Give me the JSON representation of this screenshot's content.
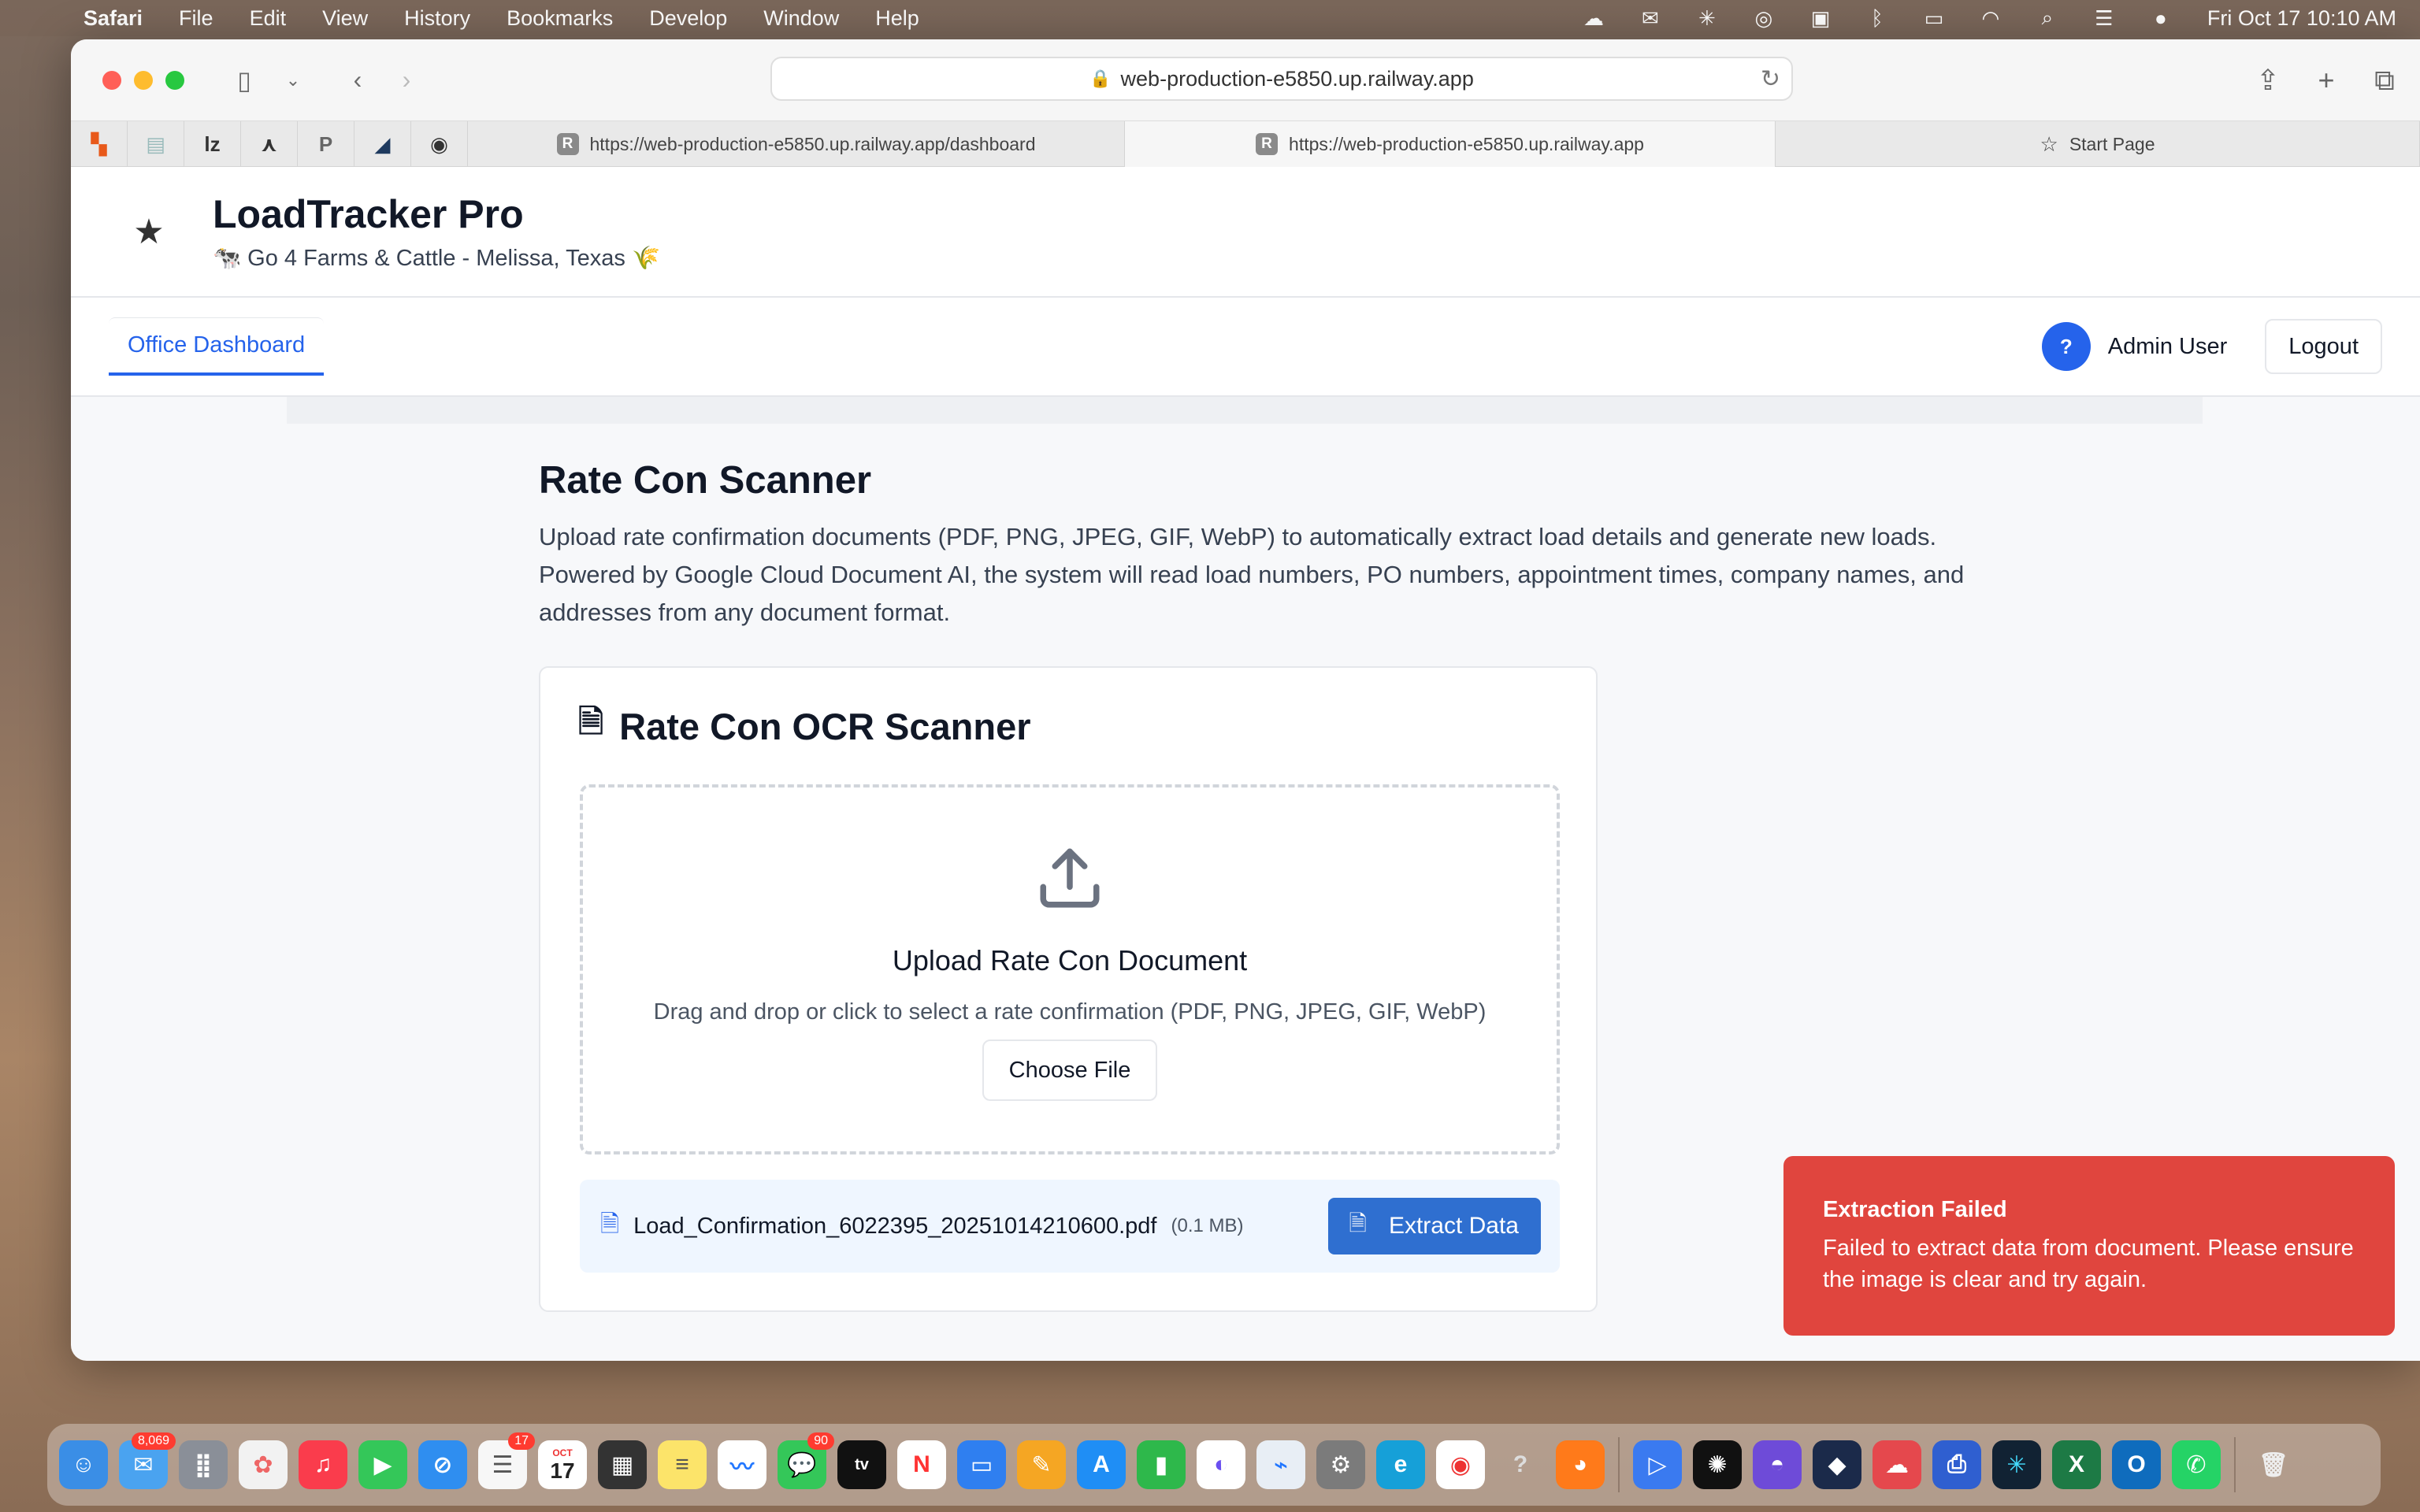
{
  "menubar": {
    "app_name": "Safari",
    "items": [
      "File",
      "Edit",
      "View",
      "History",
      "Bookmarks",
      "Develop",
      "Window",
      "Help"
    ],
    "clock": "Fri Oct 17  10:10 AM",
    "status_icons": [
      "creative-cloud-icon",
      "outlook-icon",
      "gear-icon",
      "chatgpt-icon",
      "notification-icon",
      "bluetooth-icon",
      "battery-icon",
      "wifi-icon",
      "search-icon",
      "control-center-icon",
      "siri-icon"
    ]
  },
  "browser": {
    "address": "web-production-e5850.up.railway.app",
    "tabs": [
      {
        "label": "https://web-production-e5850.up.railway.app/dashboard",
        "favicon": "R"
      },
      {
        "label": "https://web-production-e5850.up.railway.app",
        "favicon": "R"
      },
      {
        "label": "Start Page"
      }
    ],
    "pinned_tabs": [
      "pinned-tab-1",
      "pinned-tab-2",
      "pinned-tab-lz",
      "pinned-tab-a",
      "pinned-tab-p",
      "pinned-tab-flag",
      "pinned-tab-circle"
    ]
  },
  "header": {
    "title": "LoadTracker Pro",
    "subtitle": "🐄 Go 4 Farms & Cattle - Melissa, Texas 🌾"
  },
  "nav": {
    "tab_label": "Office Dashboard",
    "user_name": "Admin User",
    "avatar_glyph": "?",
    "logout_label": "Logout"
  },
  "main": {
    "title": "Rate Con Scanner",
    "description": "Upload rate confirmation documents (PDF, PNG, JPEG, GIF, WebP) to automatically extract load details and generate new loads. Powered by Google Cloud Document AI, the system will read load numbers, PO numbers, appointment times, company names, and addresses from any document format.",
    "card": {
      "title": "Rate Con OCR Scanner",
      "upload_title": "Upload Rate Con Document",
      "upload_hint": "Drag and drop or click to select a rate confirmation (PDF, PNG, JPEG, GIF, WebP)",
      "choose_label": "Choose File",
      "file_name": "Load_Confirmation_6022395_20251014210600.pdf",
      "file_size": "(0.1 MB)",
      "extract_label": "Extract Data"
    }
  },
  "toast": {
    "title": "Extraction Failed",
    "message": "Failed to extract data from document. Please ensure the image is clear and try again.",
    "color": "#e0453e"
  },
  "dock": {
    "badges": {
      "mail": "8,069",
      "reminders": "17",
      "messages": "90"
    },
    "calendar_month": "OCT",
    "calendar_day": "17"
  }
}
